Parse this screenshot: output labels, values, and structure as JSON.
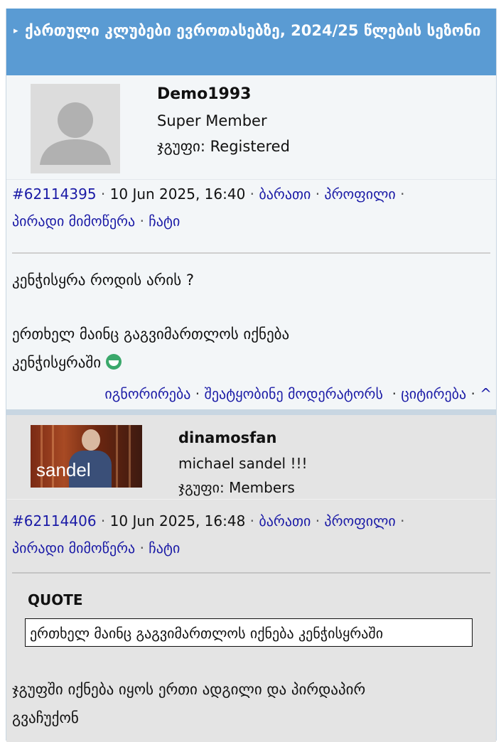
{
  "topic": {
    "title": "ქართული კლუბები ევროთასებზე, 2024/25 წლების სეზონი"
  },
  "posts": [
    {
      "username": "Demo1993",
      "member_title": "Super Member",
      "group": "ჯგუფი: Registered",
      "post_id": "#62114395",
      "date": "10 Jun 2025, 16:40",
      "links": {
        "card": "ბარათი",
        "profile": "პროფილი",
        "pm": "პირადი მიმოწერა",
        "chat": "ჩატი"
      },
      "body": [
        "კენჭისყრა როდის არის ?",
        "ერთხელ მაინც გაგვიმართლოს იქნება",
        "კენჭისყრაში"
      ],
      "actions": {
        "ignore": "იგნორირება",
        "report": "შეატყობინე მოდერატორს",
        "quote": "ციტირება",
        "top": "^"
      }
    },
    {
      "username": "dinamosfan",
      "member_title": "michael sandel !!!",
      "group": "ჯგუფი: Members",
      "avatar_caption": "sandel",
      "post_id": "#62114406",
      "date": "10 Jun 2025, 16:48",
      "links": {
        "card": "ბარათი",
        "profile": "პროფილი",
        "pm": "პირადი მიმოწერა",
        "chat": "ჩატი"
      },
      "quote_label": "QUOTE",
      "quote_text": "ერთხელ მაინც გაგვიმართლოს იქნება კენჭისყრაში",
      "body": [
        "ჯგუფში იქნება იყოს ერთი ადგილი და პირდაპირ",
        "გვაჩუქონ"
      ]
    }
  ],
  "colors": {
    "header_bg": "#5a9bd3",
    "link": "#1a1aa6",
    "post1_bg": "#f3f6f8",
    "post2_bg": "#e4e4e4"
  },
  "icons": {
    "header_arrow": "caret-right-icon",
    "emoji": "grin-emoji-icon"
  }
}
